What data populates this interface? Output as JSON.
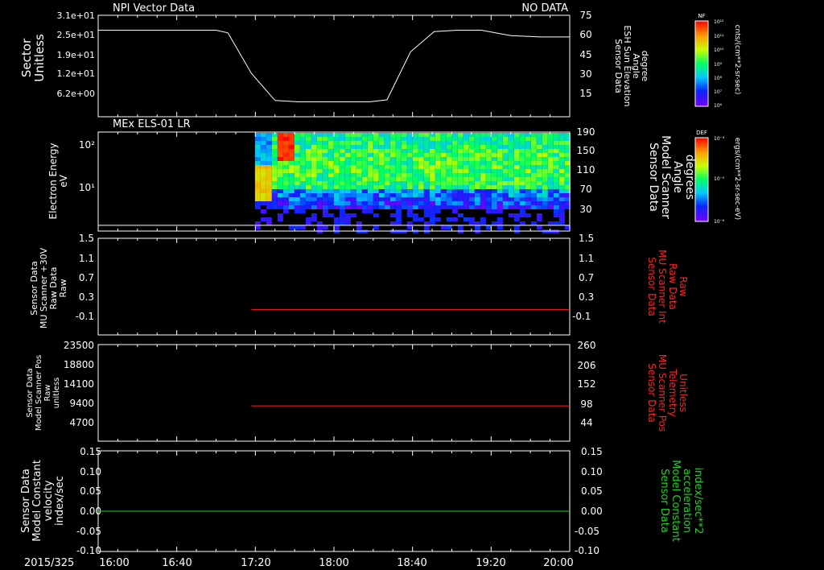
{
  "date_label": "2015/325",
  "time_ticks": [
    "16:00",
    "16:40",
    "17:20",
    "18:00",
    "18:40",
    "19:20",
    "20:00"
  ],
  "colors": {
    "background": "#000000",
    "axis": "#ffffff",
    "red_trace": "#ff2020",
    "green_trace": "#21d021",
    "red_label": "#ff2020",
    "green_label": "#21d021"
  },
  "colorbars": [
    {
      "tag": "NF",
      "unit": "cnts/(cm**2-sr-sec)",
      "tick_labels": [
        "10¹²",
        "10¹¹",
        "10¹⁰",
        "10⁹",
        "10⁸",
        "10⁷",
        "10⁶"
      ]
    },
    {
      "tag": "DEF",
      "unit": "ergs/(cm**2-sr-sec-eV)",
      "tick_labels": [
        "10⁻⁴",
        "10⁻⁵",
        "10⁻⁶"
      ]
    }
  ],
  "chart_data": [
    {
      "type": "line",
      "title": "NPI Vector Data",
      "status": "NO DATA",
      "ylabel_left": [
        "Sector",
        "Unitless"
      ],
      "left_ticks": [
        "3.1e+01",
        "2.5e+01",
        "1.9e+01",
        "1.2e+01",
        "6.2e+00"
      ],
      "ylabel_right": [
        "Sensor Data",
        "ESH Sun Elevation",
        "Angle",
        "degree"
      ],
      "right_ticks": [
        "75",
        "60",
        "45",
        "30",
        "15"
      ],
      "right_ylim": [
        0,
        75
      ],
      "series": [
        {
          "color": "white",
          "points": [
            [
              16.0,
              64.0
            ],
            [
              17.0,
              64.0
            ],
            [
              17.1,
              62.0
            ],
            [
              17.3,
              32.0
            ],
            [
              17.5,
              12.0
            ],
            [
              17.7,
              11.0
            ],
            [
              18.3,
              11.0
            ],
            [
              18.45,
              12.5
            ],
            [
              18.65,
              48.0
            ],
            [
              18.85,
              63.0
            ],
            [
              19.05,
              64.0
            ],
            [
              19.25,
              64.0
            ],
            [
              19.5,
              60.0
            ],
            [
              19.75,
              59.0
            ],
            [
              20.0,
              59.0
            ]
          ]
        }
      ]
    },
    {
      "type": "heatmap",
      "title": "MEx ELS-01 LR",
      "ylabel_left": [
        "Electron Energy",
        "eV"
      ],
      "left_ticks": [
        "10²",
        "10¹"
      ],
      "ylabel_right": [
        "Sensor Data",
        "Model Scanner",
        "Angle",
        "degrees"
      ],
      "right_ticks": [
        "190",
        "150",
        "110",
        "70",
        "30"
      ],
      "right_ylim": [
        0,
        190
      ],
      "x_range": [
        17.33,
        20.0
      ],
      "y_range_log10": [
        0.15,
        2.3
      ],
      "reference_level": 11
    },
    {
      "type": "line",
      "ylabel_left": [
        "Sensor Data",
        "MU Scanner +30V",
        "Raw Data",
        "Raw"
      ],
      "left_ticks": [
        "1.5",
        "1.1",
        "0.7",
        "0.3",
        "-0.1"
      ],
      "left_ylim": [
        -0.4,
        1.5
      ],
      "ylabel_right": [
        "Sensor Data",
        "MU Scanner Int",
        "Raw Data",
        "Raw"
      ],
      "right_ticks": [
        "1.5",
        "1.1",
        "0.7",
        "0.3",
        "-0.1"
      ],
      "series": [
        {
          "color": "red",
          "x": [
            17.3,
            20.0
          ],
          "y": [
            0.1,
            0.1
          ]
        }
      ]
    },
    {
      "type": "line",
      "ylabel_left": [
        "Sensor Data",
        "Model Scanner Pos",
        "Raw",
        "unitless"
      ],
      "left_ticks": [
        "23500",
        "18800",
        "14100",
        "9400",
        "4700"
      ],
      "left_ylim": [
        0,
        23500
      ],
      "ylabel_right": [
        "Sensor Data",
        "MU Scanner Pos",
        "Telemetry",
        "Unitless"
      ],
      "right_ticks": [
        "260",
        "206",
        "152",
        "98",
        "44"
      ],
      "series": [
        {
          "color": "red",
          "x": [
            17.3,
            20.0
          ],
          "y": [
            8600,
            8600
          ]
        }
      ]
    },
    {
      "type": "line",
      "ylabel_left": [
        "Sensor Data",
        "Model Constant",
        "velocity",
        "index/sec"
      ],
      "left_ticks": [
        "0.15",
        "0.10",
        "0.05",
        "0.00",
        "-0.05",
        "-0.10"
      ],
      "left_ylim": [
        -0.1,
        0.15
      ],
      "ylabel_right": [
        "Sensor Data",
        "Model Constant",
        "acceleration",
        "index/sec**2"
      ],
      "right_ticks": [
        "0.15",
        "0.10",
        "0.05",
        "0.00",
        "-0.05",
        "-0.10"
      ],
      "series": [
        {
          "color": "green",
          "x": [
            16.0,
            20.0
          ],
          "y": [
            0.0,
            0.0
          ]
        }
      ]
    }
  ]
}
